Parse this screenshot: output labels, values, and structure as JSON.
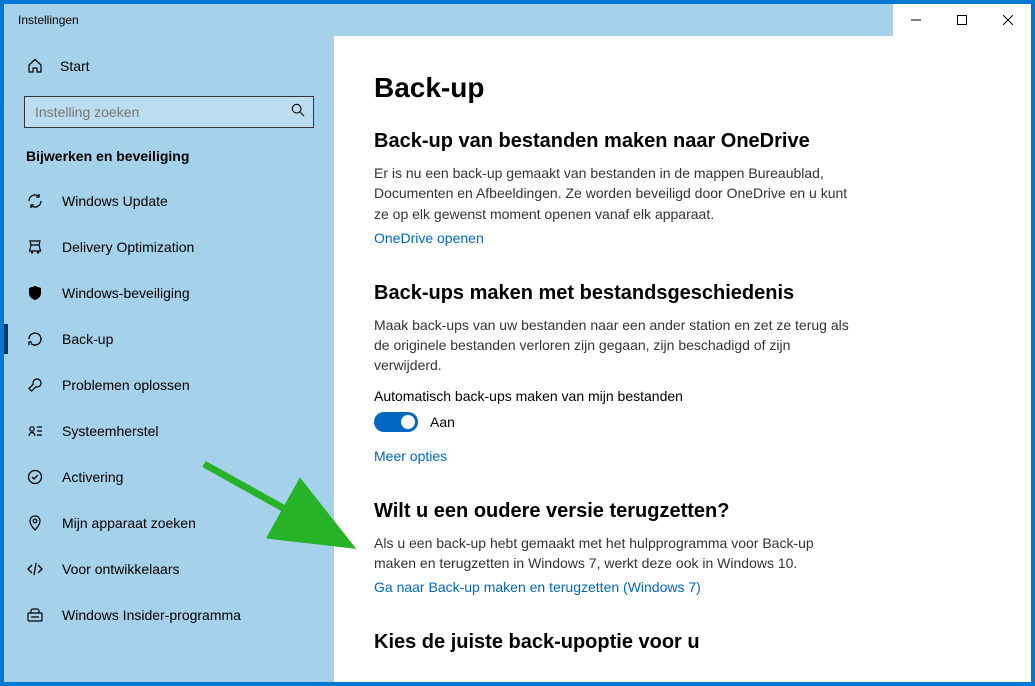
{
  "window": {
    "title": "Instellingen"
  },
  "sidebar": {
    "home": "Start",
    "search_placeholder": "Instelling zoeken",
    "section": "Bijwerken en beveiliging",
    "items": [
      {
        "label": "Windows Update",
        "icon": "sync"
      },
      {
        "label": "Delivery Optimization",
        "icon": "delivery"
      },
      {
        "label": "Windows-beveiliging",
        "icon": "shield"
      },
      {
        "label": "Back-up",
        "icon": "backup",
        "active": true
      },
      {
        "label": "Problemen oplossen",
        "icon": "troubleshoot"
      },
      {
        "label": "Systeemherstel",
        "icon": "recovery"
      },
      {
        "label": "Activering",
        "icon": "activation"
      },
      {
        "label": "Mijn apparaat zoeken",
        "icon": "find"
      },
      {
        "label": "Voor ontwikkelaars",
        "icon": "dev"
      },
      {
        "label": "Windows Insider-programma",
        "icon": "insider"
      }
    ]
  },
  "main": {
    "title": "Back-up",
    "s1": {
      "heading": "Back-up van bestanden maken naar OneDrive",
      "body": "Er is nu een back-up gemaakt van bestanden in de mappen Bureaublad, Documenten en Afbeeldingen. Ze worden beveiligd door OneDrive en u kunt ze op elk gewenst moment openen vanaf elk apparaat.",
      "link": "OneDrive openen"
    },
    "s2": {
      "heading": "Back-ups maken met bestandsgeschiedenis",
      "body": "Maak back-ups van uw bestanden naar een ander station en zet ze terug als de originele bestanden verloren zijn gegaan, zijn beschadigd of zijn verwijderd.",
      "toggle_label": "Automatisch back-ups maken van mijn bestanden",
      "toggle_state": "Aan",
      "link": "Meer opties"
    },
    "s3": {
      "heading": "Wilt u een oudere versie terugzetten?",
      "body": "Als u een back-up hebt gemaakt met het hulpprogramma voor Back-up maken en terugzetten in Windows 7, werkt deze ook in Windows 10.",
      "link": "Ga naar Back-up maken en terugzetten (Windows 7)"
    },
    "s4": {
      "heading": "Kies de juiste back-upoptie voor u"
    }
  }
}
